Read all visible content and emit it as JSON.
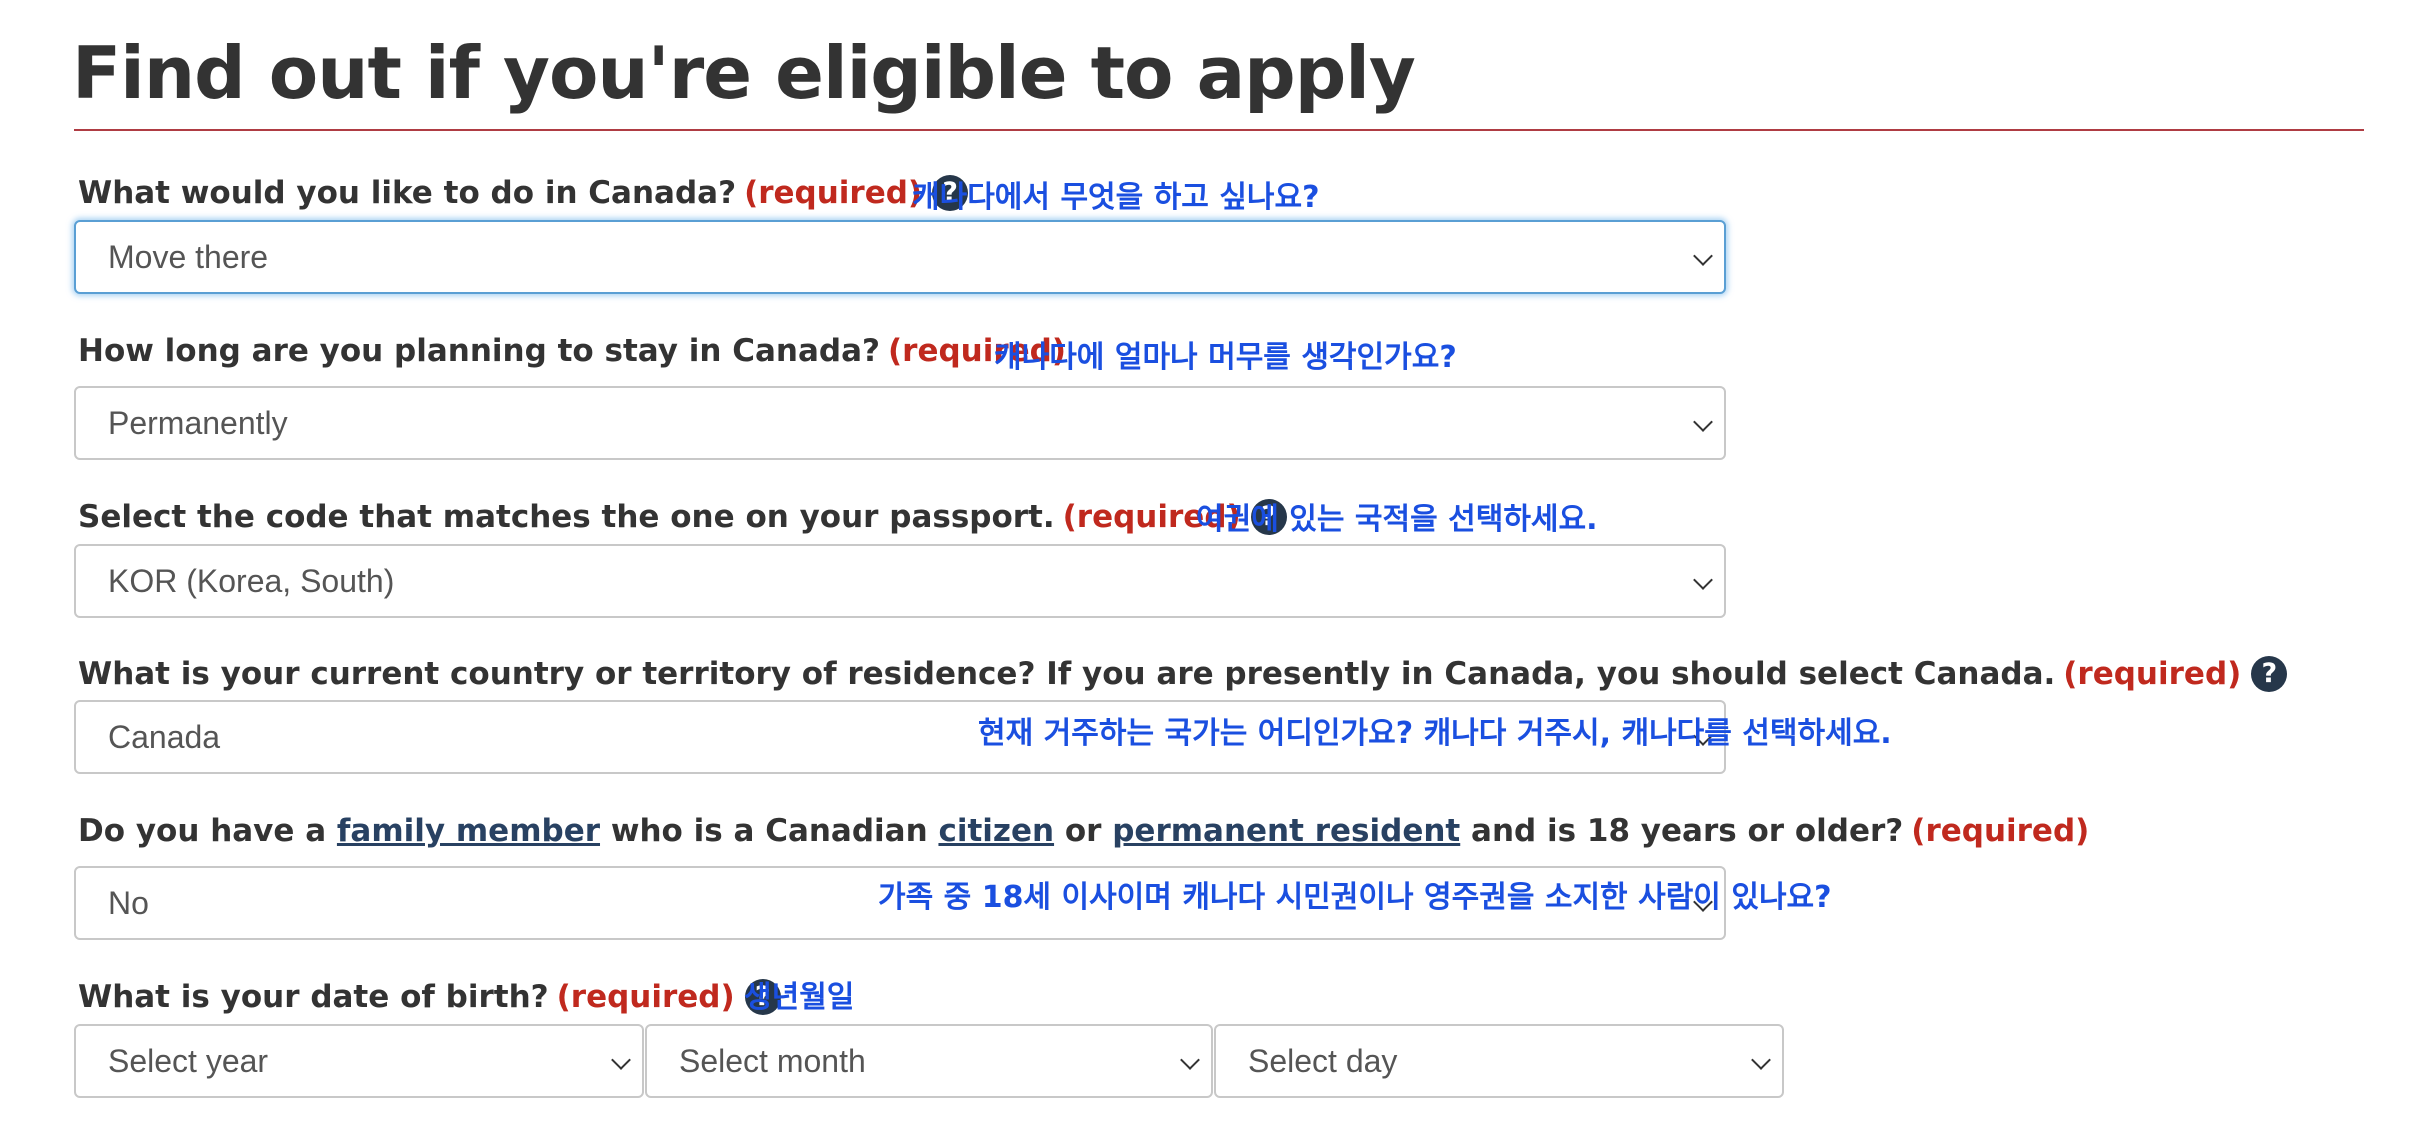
{
  "page_title": "Find out if you're eligible to apply",
  "required_label": "(required)",
  "questions": {
    "purpose": {
      "label": "What would you like to do in Canada?",
      "korean": "캐나다에서 무엇을 하고 싶나요?",
      "value": "Move there"
    },
    "duration": {
      "label": "How long are you planning to stay in Canada?",
      "korean": "캐나다에 얼마나 머무를 생각인가요?",
      "value": "Permanently"
    },
    "passport": {
      "label": "Select the code that matches the one on your passport.",
      "korean": "여권에 있는 국적을 선택하세요.",
      "value": "KOR (Korea, South)"
    },
    "residence": {
      "label": "What is your current country or territory of residence? If you are presently in Canada, you should select Canada.",
      "korean": "현재 거주하는 국가는 어디인가요? 캐나다 거주시, 캐나다를 선택하세요.",
      "value": "Canada"
    },
    "family": {
      "label_part1": "Do you have a",
      "link_family_member": "family member",
      "label_part2": "who is a Canadian",
      "link_citizen": "citizen",
      "label_part3": "or",
      "link_permanent_resident": "permanent resident",
      "label_part4": "and is 18 years or older?",
      "korean": "가족 중 18세 이사이며 캐나다 시민권이나 영주권을 소지한 사람이 있나요?",
      "value": "No"
    },
    "dob": {
      "label": "What is your date of birth?",
      "korean": "생년월일",
      "year_placeholder": "Select year",
      "month_placeholder": "Select month",
      "day_placeholder": "Select day"
    }
  },
  "help_icon_glyph": "?",
  "icons": [
    "help-icon",
    "chevron-down-icon"
  ],
  "colors": {
    "title_rule": "#af3c43",
    "required": "#c0291e",
    "korean_annotation": "#1a4fe0",
    "help_icon_bg": "#26374a",
    "focus_border": "#5a9fd4"
  }
}
